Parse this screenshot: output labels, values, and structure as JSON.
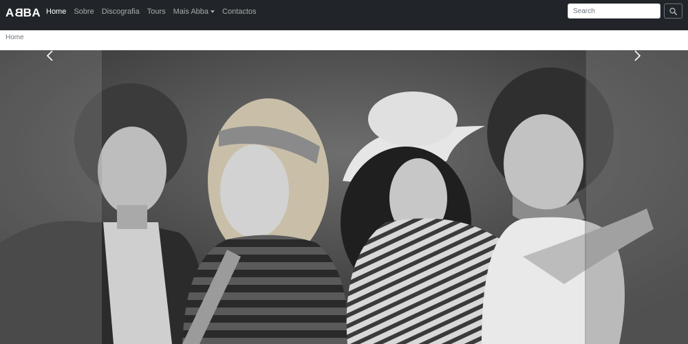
{
  "brand": {
    "left": "A",
    "rev": "B",
    "rest": "BA"
  },
  "nav": {
    "items": [
      {
        "label": "Home",
        "active": true
      },
      {
        "label": "Sobre"
      },
      {
        "label": "Discografia"
      },
      {
        "label": "Tours"
      },
      {
        "label": "Mais Abba",
        "dropdown": true
      },
      {
        "label": "Contactos"
      }
    ]
  },
  "search": {
    "placeholder": "Search",
    "button_icon": "search-icon"
  },
  "breadcrumb": {
    "current": "Home"
  },
  "carousel": {
    "slide_image": "band-photo",
    "prev_icon": "chevron-left-icon",
    "next_icon": "chevron-right-icon"
  },
  "colors": {
    "navbar": "#212529",
    "active_link": "#ffffff",
    "link": "#9a9da0"
  }
}
